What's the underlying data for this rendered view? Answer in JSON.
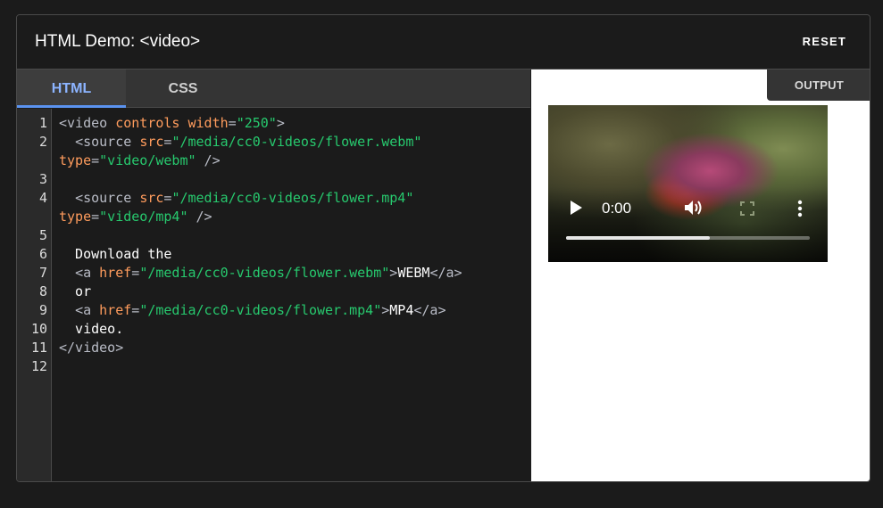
{
  "header": {
    "title": "HTML Demo: <video>",
    "reset_label": "RESET"
  },
  "tabs": {
    "html_label": "HTML",
    "css_label": "CSS"
  },
  "output": {
    "tab_label": "OUTPUT"
  },
  "editor": {
    "line_numbers": [
      "1",
      "2",
      "",
      "3",
      "4",
      "",
      "5",
      "6",
      "7",
      "8",
      "9",
      "10",
      "11",
      "12"
    ],
    "code_lines": [
      [
        {
          "c": "tag",
          "t": "<video "
        },
        {
          "c": "attr",
          "t": "controls"
        },
        {
          "c": "attr",
          "t": " width"
        },
        {
          "c": "tag",
          "t": "="
        },
        {
          "c": "str",
          "t": "\"250\""
        },
        {
          "c": "tag",
          "t": ">"
        }
      ],
      [
        {
          "c": "txt",
          "t": "  "
        },
        {
          "c": "tag",
          "t": "<source "
        },
        {
          "c": "attr",
          "t": "src"
        },
        {
          "c": "tag",
          "t": "="
        },
        {
          "c": "str",
          "t": "\"/media/cc0-videos/flower.webm\""
        }
      ],
      [
        {
          "c": "attr",
          "t": "type"
        },
        {
          "c": "tag",
          "t": "="
        },
        {
          "c": "str",
          "t": "\"video/webm\""
        },
        {
          "c": "tag",
          "t": " />"
        }
      ],
      [],
      [
        {
          "c": "txt",
          "t": "  "
        },
        {
          "c": "tag",
          "t": "<source "
        },
        {
          "c": "attr",
          "t": "src"
        },
        {
          "c": "tag",
          "t": "="
        },
        {
          "c": "str",
          "t": "\"/media/cc0-videos/flower.mp4\""
        }
      ],
      [
        {
          "c": "attr",
          "t": "type"
        },
        {
          "c": "tag",
          "t": "="
        },
        {
          "c": "str",
          "t": "\"video/mp4\""
        },
        {
          "c": "tag",
          "t": " />"
        }
      ],
      [],
      [
        {
          "c": "txt",
          "t": "  Download the"
        }
      ],
      [
        {
          "c": "txt",
          "t": "  "
        },
        {
          "c": "tag",
          "t": "<a "
        },
        {
          "c": "attr",
          "t": "href"
        },
        {
          "c": "tag",
          "t": "="
        },
        {
          "c": "str",
          "t": "\"/media/cc0-videos/flower.webm\""
        },
        {
          "c": "tag",
          "t": ">"
        },
        {
          "c": "txt",
          "t": "WEBM"
        },
        {
          "c": "tag",
          "t": "</a>"
        }
      ],
      [
        {
          "c": "txt",
          "t": "  or"
        }
      ],
      [
        {
          "c": "txt",
          "t": "  "
        },
        {
          "c": "tag",
          "t": "<a "
        },
        {
          "c": "attr",
          "t": "href"
        },
        {
          "c": "tag",
          "t": "="
        },
        {
          "c": "str",
          "t": "\"/media/cc0-videos/flower.mp4\""
        },
        {
          "c": "tag",
          "t": ">"
        },
        {
          "c": "txt",
          "t": "MP4"
        },
        {
          "c": "tag",
          "t": "</a>"
        }
      ],
      [
        {
          "c": "txt",
          "t": "  video."
        }
      ],
      [
        {
          "c": "tag",
          "t": "</video>"
        }
      ],
      []
    ]
  },
  "video": {
    "current_time": "0:00",
    "progress_fraction": 0.59
  },
  "colors": {
    "tag": "#b9bcc6",
    "attribute": "#ff9c5d",
    "string": "#27c96e",
    "active_tab": "#8cb4ff"
  },
  "icons": {
    "play": "play-icon",
    "volume": "volume-icon",
    "fullscreen": "fullscreen-icon",
    "more": "more-vert-icon"
  }
}
